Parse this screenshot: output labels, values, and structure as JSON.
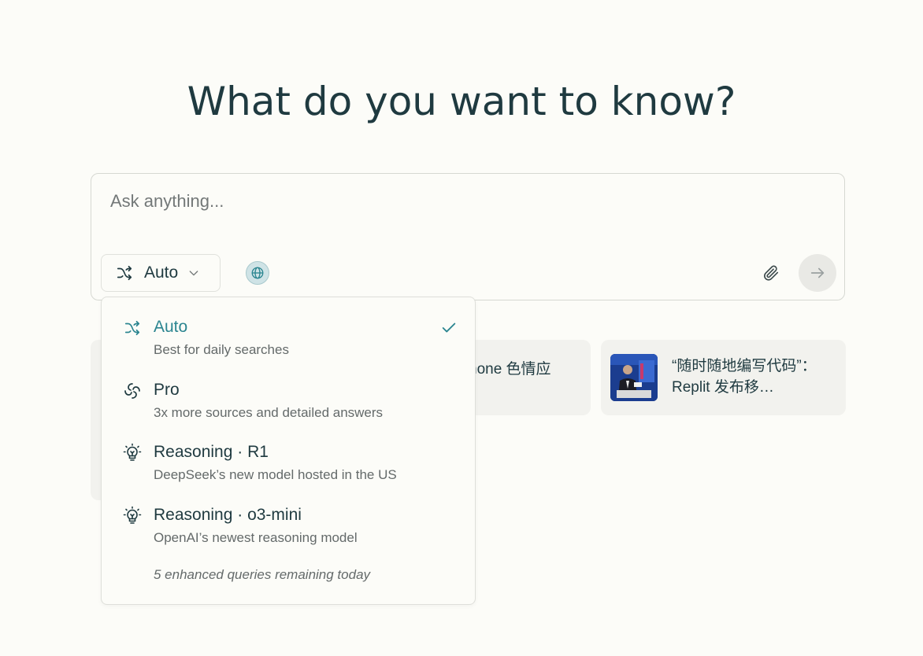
{
  "headline": "What do you want to know?",
  "composer": {
    "placeholder": "Ask anything...",
    "mode_label": "Auto"
  },
  "cards": [
    {
      "text": "hone 色情应"
    },
    {
      "text": "“随时随地编写代码”：Replit 发布移…"
    }
  ],
  "dropdown": {
    "items": [
      {
        "title": "Auto",
        "description": "Best for daily searches",
        "icon": "shuffle-icon",
        "selected": true
      },
      {
        "title": "Pro",
        "description": "3x more sources and detailed answers",
        "icon": "pro-icon",
        "selected": false
      },
      {
        "title": "Reasoning · R1",
        "description": "DeepSeek’s new model hosted in the US",
        "icon": "lightbulb-icon",
        "selected": false
      },
      {
        "title": "Reasoning · o3-mini",
        "description": "OpenAI’s newest reasoning model",
        "icon": "lightbulb-icon",
        "selected": false
      }
    ],
    "remaining": "5 enhanced queries remaining today"
  },
  "colors": {
    "accent": "#2b8590",
    "text": "#1f3a40",
    "background": "#fcfcf8",
    "card": "#f2f2ee"
  }
}
